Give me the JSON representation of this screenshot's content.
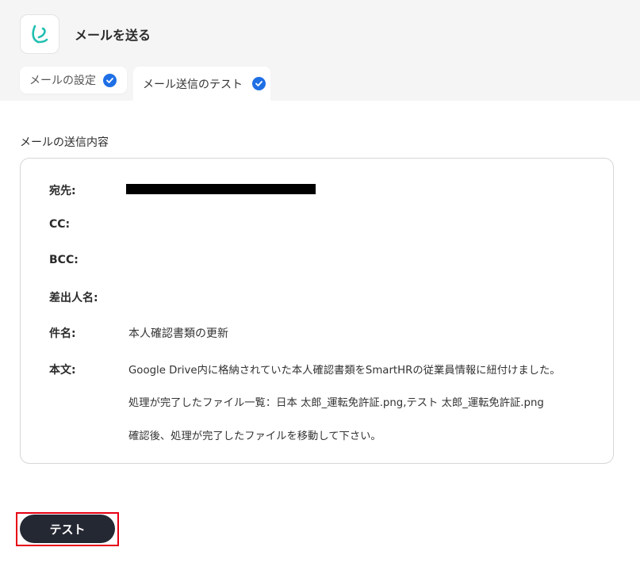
{
  "header": {
    "app_icon": "yoom-app-icon",
    "title": "メールを送る"
  },
  "tabs": [
    {
      "label": "メールの設定",
      "status": "completed"
    },
    {
      "label": "メール送信のテスト",
      "status": "completed"
    }
  ],
  "colors": {
    "accent": "#1f6fe5",
    "icon_teal": "#1fbfb0",
    "button_dark": "#242833",
    "highlight_red": "#e60012"
  },
  "section": {
    "label": "メールの送信内容"
  },
  "fields": {
    "to": {
      "label": "宛先:",
      "value_redacted": true
    },
    "cc": {
      "label": "CC:",
      "value": ""
    },
    "bcc": {
      "label": "BCC:",
      "value": ""
    },
    "sender": {
      "label": "差出人名:",
      "value": ""
    },
    "subject": {
      "label": "件名:",
      "value": "本人確認書類の更新"
    },
    "body": {
      "label": "本文:",
      "lines": [
        "Google Drive内に格納されていた本人確認書類をSmartHRの従業員情報に紐付けました。",
        "処理が完了したファイル一覧：日本 太郎_運転免許証.png,テスト 太郎_運転免許証.png",
        "確認後、処理が完了したファイルを移動して下さい。"
      ]
    }
  },
  "actions": {
    "test_label": "テスト"
  }
}
